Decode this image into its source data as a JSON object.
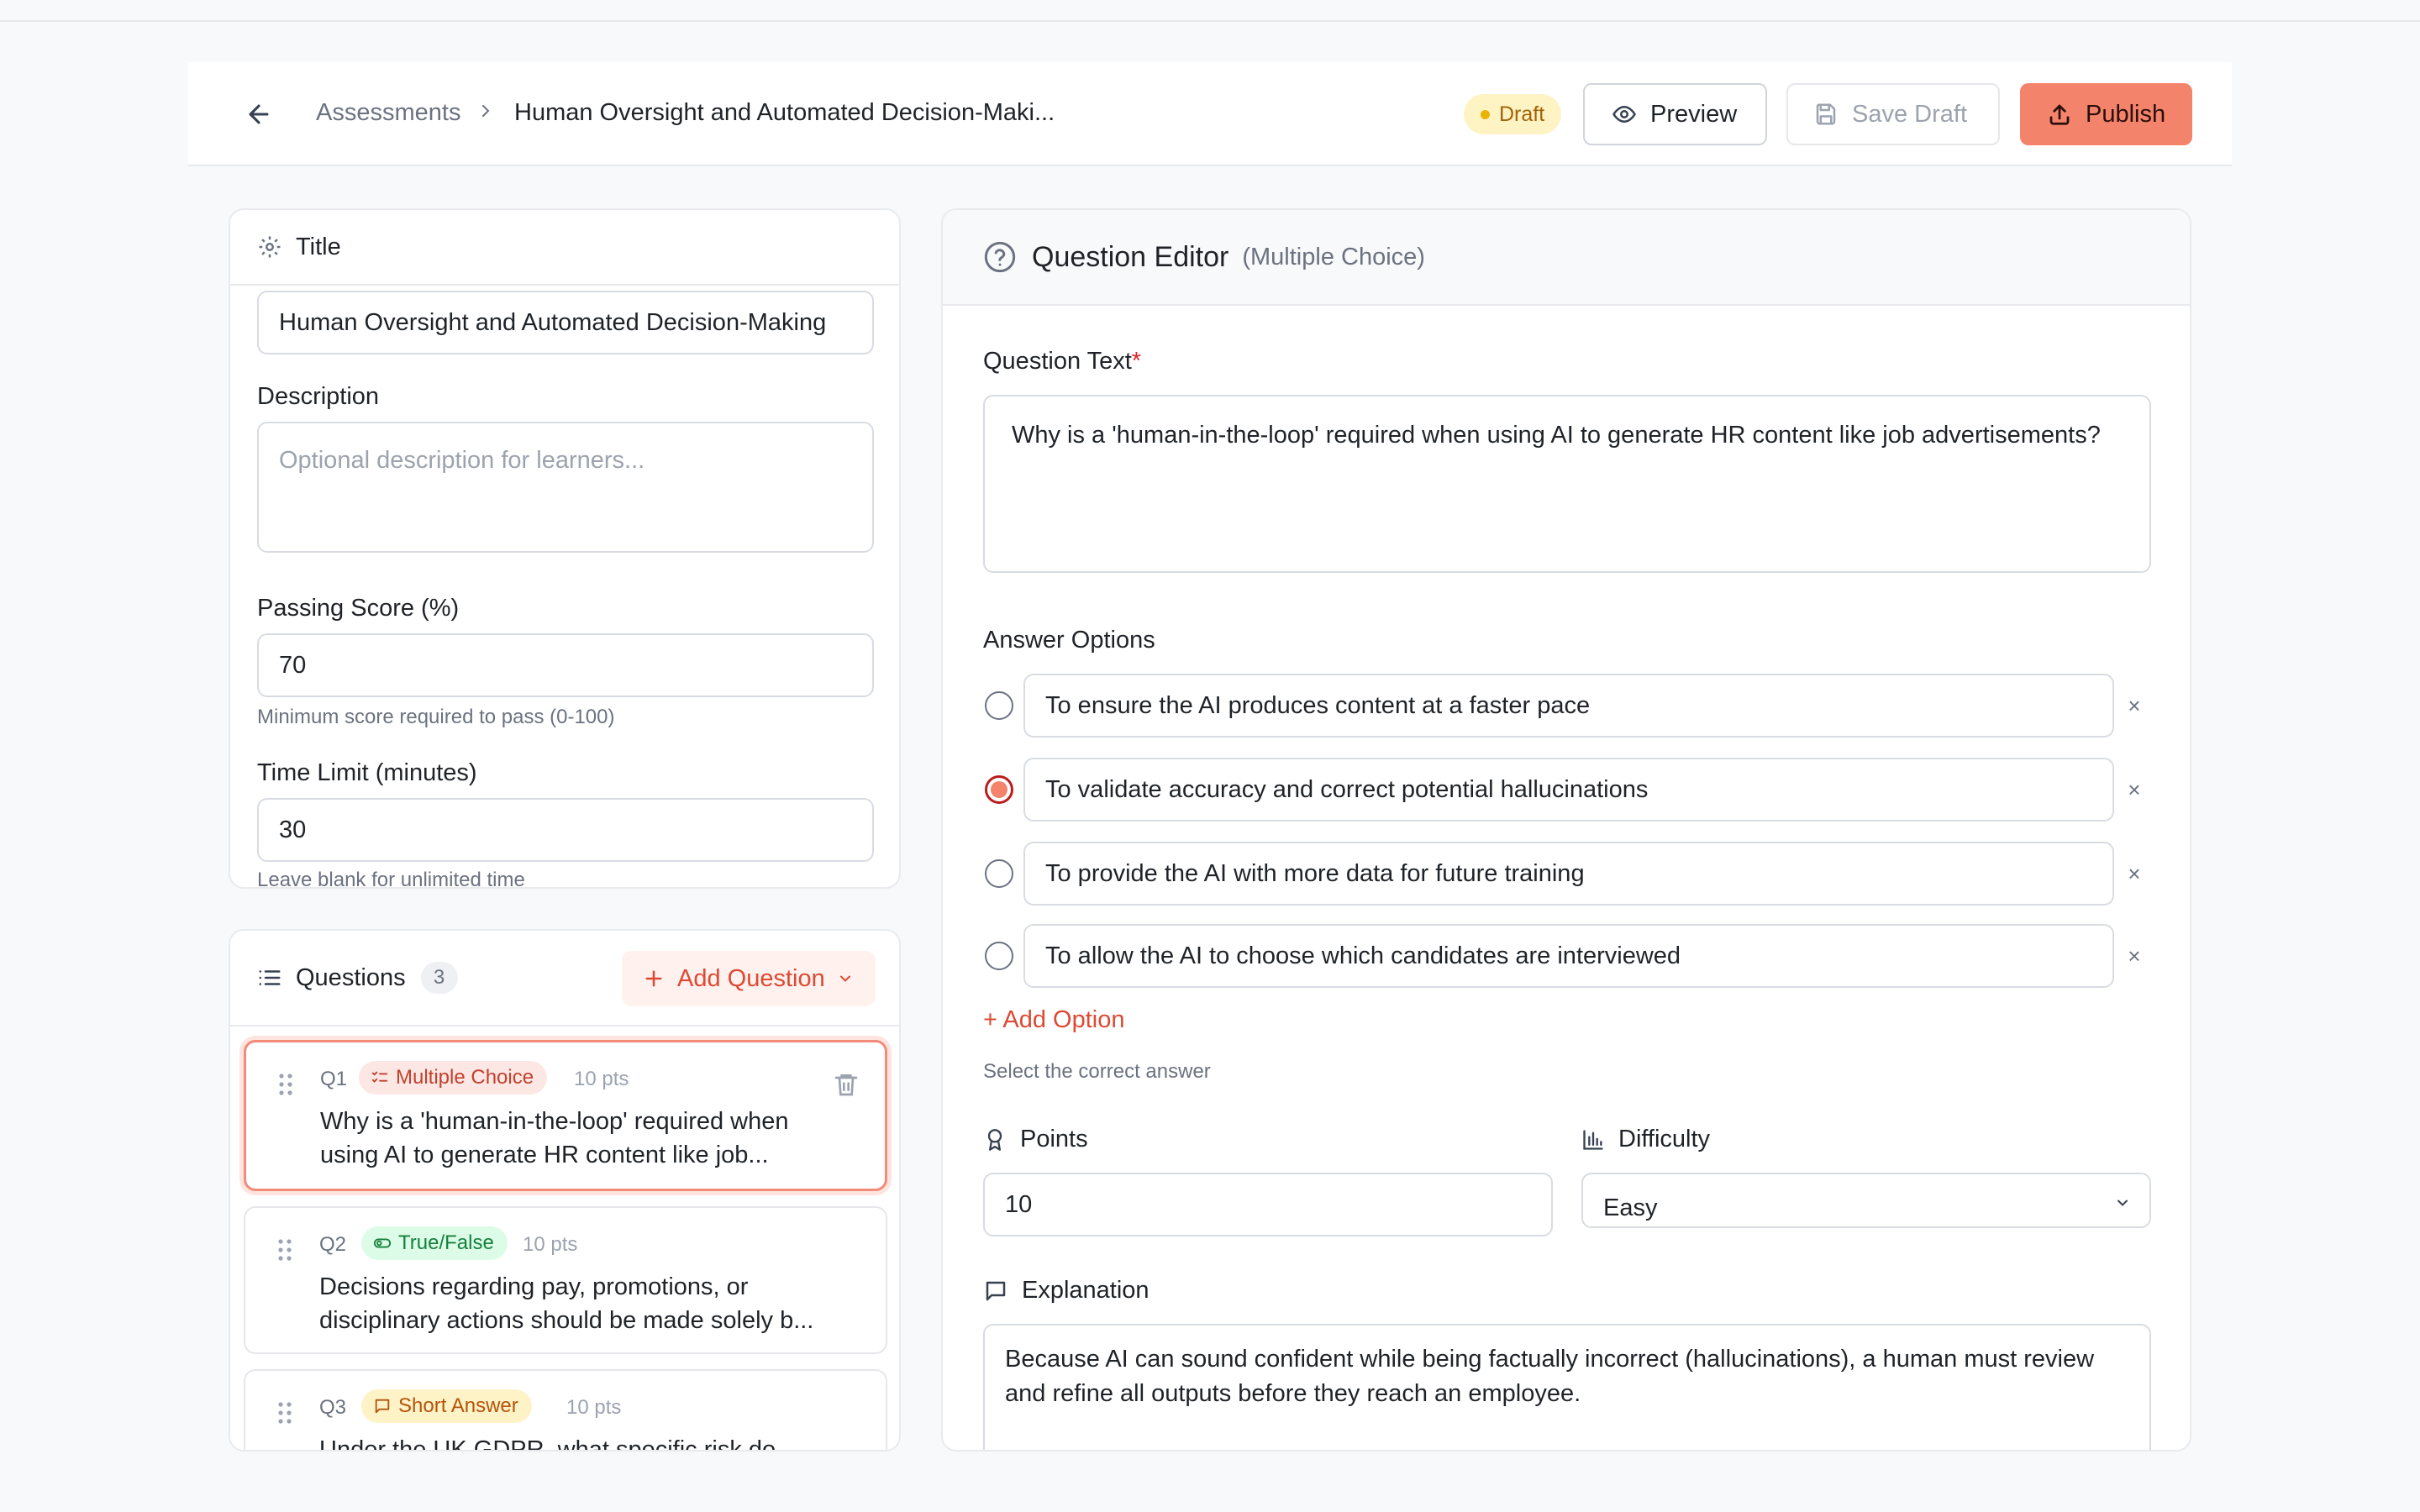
{
  "header": {
    "breadcrumb_parent": "Assessments",
    "breadcrumb_current": "Human Oversight and Automated Decision-Maki...",
    "status_badge": "Draft",
    "preview_label": "Preview",
    "save_draft_label": "Save Draft",
    "publish_label": "Publish"
  },
  "settings": {
    "section_title": "Title",
    "title_value": "Human Oversight and Automated Decision-Making",
    "description_label": "Description",
    "description_placeholder": "Optional description for learners...",
    "passing_score_label": "Passing Score (%)",
    "passing_score_value": "70",
    "passing_score_hint": "Minimum score required to pass (0-100)",
    "time_limit_label": "Time Limit (minutes)",
    "time_limit_value": "30",
    "time_limit_hint": "Leave blank for unlimited time"
  },
  "questions": {
    "title": "Questions",
    "count": "3",
    "add_label": "Add Question",
    "items": [
      {
        "num": "Q1",
        "type": "Multiple Choice",
        "points": "10 pts",
        "text": "Why is a 'human-in-the-loop' required when using AI to generate HR content like job..."
      },
      {
        "num": "Q2",
        "type": "True/False",
        "points": "10 pts",
        "text": "Decisions regarding pay, promotions, or disciplinary actions should be made solely b..."
      },
      {
        "num": "Q3",
        "type": "Short Answer",
        "points": "10 pts",
        "text": "Under the UK GDPR, what specific risk do..."
      }
    ]
  },
  "editor": {
    "title": "Question Editor",
    "subtitle": "(Multiple Choice)",
    "question_text_label": "Question Text",
    "required_mark": "*",
    "question_text_value": "Why is a 'human-in-the-loop' required when using AI to generate HR content like job advertisements?",
    "answer_options_label": "Answer Options",
    "options": [
      {
        "text": "To ensure the AI produces content at a faster pace",
        "selected": false
      },
      {
        "text": "To validate accuracy and correct potential hallucinations",
        "selected": true
      },
      {
        "text": "To provide the AI with more data for future training",
        "selected": false
      },
      {
        "text": "To allow the AI to choose which candidates are interviewed",
        "selected": false
      }
    ],
    "remove_symbol": "×",
    "add_option_label": "+ Add Option",
    "select_correct_hint": "Select the correct answer",
    "points_label": "Points",
    "points_value": "10",
    "difficulty_label": "Difficulty",
    "difficulty_value": "Easy",
    "explanation_label": "Explanation",
    "explanation_value": "Because AI can sound confident while being factually incorrect (hallucinations), a human must review and refine all outputs before they reach an employee."
  },
  "colors": {
    "accent": "#f4836b",
    "accent_text": "#dc4a33",
    "draft_bg": "#fef4c3"
  }
}
